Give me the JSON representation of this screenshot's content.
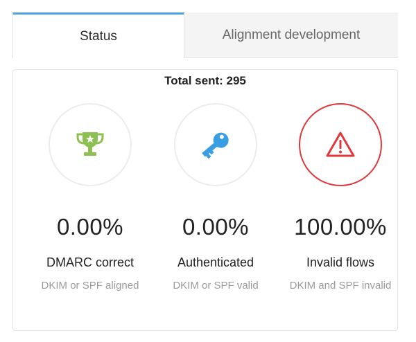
{
  "tabs": [
    {
      "label": "Status",
      "active": true
    },
    {
      "label": "Alignment development",
      "active": false
    }
  ],
  "total_sent": "Total sent: 295",
  "colors": {
    "accent": "#4aa3df",
    "trophy": "#8cc152",
    "key": "#3a9ee3",
    "alert": "#e0383a"
  },
  "cards": [
    {
      "icon": "trophy-icon",
      "value": "0.00%",
      "label": "DMARC correct",
      "sublabel": "DKIM or SPF aligned"
    },
    {
      "icon": "key-icon",
      "value": "0.00%",
      "label": "Authenticated",
      "sublabel": "DKIM or SPF valid"
    },
    {
      "icon": "warning-icon",
      "value": "100.00%",
      "label": "Invalid flows",
      "sublabel": "DKIM and SPF invalid"
    }
  ]
}
